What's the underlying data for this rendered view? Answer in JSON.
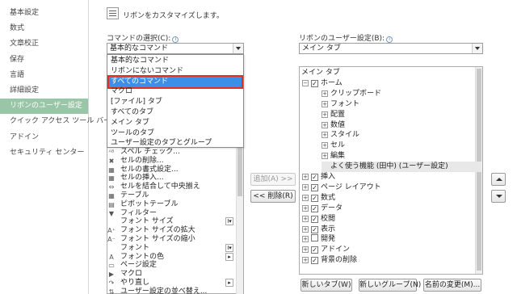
{
  "nav": {
    "items": [
      "基本設定",
      "数式",
      "文章校正",
      "保存",
      "言語",
      "詳細設定",
      "リボンのユーザー設定",
      "クイック アクセス ツール バー",
      "アドイン",
      "セキュリティ センター"
    ],
    "active_index": 6
  },
  "header": {
    "title": "リボンをカスタマイズします。"
  },
  "left": {
    "label": "コマンドの選択(C):",
    "selected": "基本的なコマンド",
    "dropdown": [
      "基本的なコマンド",
      "リボンにないコマンド",
      "すべてのコマンド",
      "マクロ",
      "[ファイル] タブ",
      "すべてのタブ",
      "メイン タブ",
      "ツールのタブ",
      "ユーザー設定のタブとグループ"
    ],
    "dropdown_selected_index": 2,
    "commands": [
      {
        "label": "スペル チェック...",
        "icon": "abc-icon"
      },
      {
        "label": "セルの削除...",
        "icon": "delete-cells-icon"
      },
      {
        "label": "セルの書式設定...",
        "icon": "format-cells-icon"
      },
      {
        "label": "セルの挿入...",
        "icon": "insert-cells-icon"
      },
      {
        "label": "セルを結合して中央揃え",
        "icon": "merge-icon"
      },
      {
        "label": "テーブル",
        "icon": "table-icon"
      },
      {
        "label": "ピボットテーブル",
        "icon": "pivot-icon"
      },
      {
        "label": "フィルター",
        "icon": "filter-icon"
      },
      {
        "label": "フォント サイズ",
        "icon": "blank-icon",
        "sub": "I▾"
      },
      {
        "label": "フォント サイズの拡大",
        "icon": "font-grow-icon"
      },
      {
        "label": "フォント サイズの縮小",
        "icon": "font-shrink-icon"
      },
      {
        "label": "フォント",
        "icon": "blank-icon",
        "sub": "I▾"
      },
      {
        "label": "フォントの色",
        "icon": "font-color-icon",
        "sub": "▸"
      },
      {
        "label": "ページ設定",
        "icon": "page-setup-icon"
      },
      {
        "label": "マクロ",
        "icon": "macro-icon"
      },
      {
        "label": "やり直し",
        "icon": "redo-icon",
        "sub": "▸"
      },
      {
        "label": "ユーザー設定の並べ替え...",
        "icon": "sort-icon"
      }
    ]
  },
  "buttons": {
    "add": "追加(A) >>",
    "remove": "<< 削除(R)",
    "new_tab": "新しいタブ(W)",
    "new_group": "新しいグループ(N)",
    "rename": "名前の変更(M)..."
  },
  "right": {
    "label": "リボンのユーザー設定(B):",
    "selected": "メイン タブ",
    "tree": [
      {
        "label": "メイン タブ",
        "level": 0,
        "exp": "",
        "chk": false,
        "head": true
      },
      {
        "label": "ホーム",
        "level": 0,
        "exp": "⊟",
        "chk": true
      },
      {
        "label": "クリップボード",
        "level": 1,
        "exp": "⊞",
        "chk": false
      },
      {
        "label": "フォント",
        "level": 1,
        "exp": "⊞",
        "chk": false
      },
      {
        "label": "配置",
        "level": 1,
        "exp": "⊞",
        "chk": false
      },
      {
        "label": "数値",
        "level": 1,
        "exp": "⊞",
        "chk": false
      },
      {
        "label": "スタイル",
        "level": 1,
        "exp": "⊞",
        "chk": false
      },
      {
        "label": "セル",
        "level": 1,
        "exp": "⊞",
        "chk": false
      },
      {
        "label": "編集",
        "level": 1,
        "exp": "⊞",
        "chk": false
      },
      {
        "label": "よく使う機能 (田中) (ユーザー設定)",
        "level": 1,
        "exp": "",
        "chk": false,
        "hl": true
      },
      {
        "label": "挿入",
        "level": 0,
        "exp": "⊞",
        "chk": true
      },
      {
        "label": "ページ レイアウト",
        "level": 0,
        "exp": "⊞",
        "chk": true
      },
      {
        "label": "数式",
        "level": 0,
        "exp": "⊞",
        "chk": true
      },
      {
        "label": "データ",
        "level": 0,
        "exp": "⊞",
        "chk": true
      },
      {
        "label": "校閲",
        "level": 0,
        "exp": "⊞",
        "chk": true
      },
      {
        "label": "表示",
        "level": 0,
        "exp": "⊞",
        "chk": true
      },
      {
        "label": "開発",
        "level": 0,
        "exp": "⊞",
        "chk": false,
        "box": true
      },
      {
        "label": "アドイン",
        "level": 0,
        "exp": "⊞",
        "chk": true
      },
      {
        "label": "背景の削除",
        "level": 0,
        "exp": "⊞",
        "chk": true
      }
    ]
  },
  "colors": {
    "nav_active": "#9ac6a8",
    "selection": "#3b8fe6",
    "highlight_border": "#e03020"
  }
}
